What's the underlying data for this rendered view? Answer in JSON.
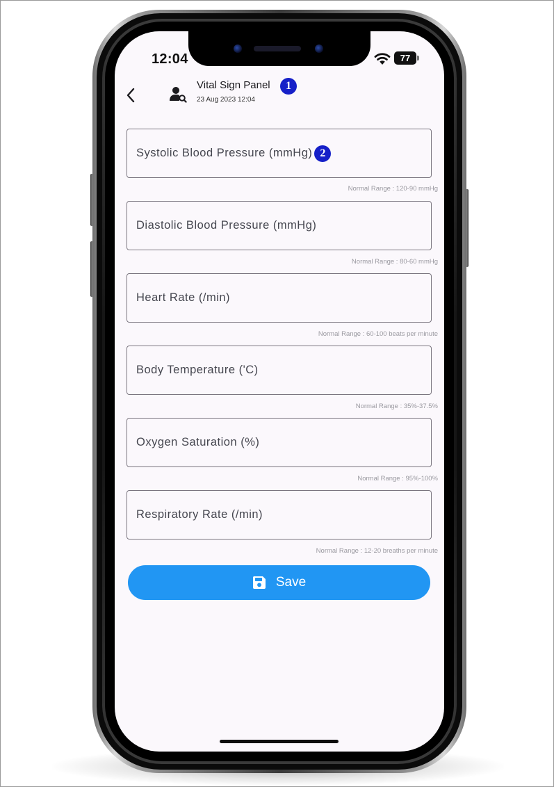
{
  "status_bar": {
    "time": "12:04",
    "battery": "77"
  },
  "header": {
    "title": "Vital Sign Panel",
    "date": "23 Aug 2023 12:04",
    "badge": "1",
    "back_icon": "chevron-left-icon",
    "user_icon": "user-search-icon"
  },
  "fields": [
    {
      "label": "Systolic Blood Pressure (mmHg)",
      "hint": "Normal Range : 120-90 mmHg",
      "badge": "2"
    },
    {
      "label": "Diastolic Blood Pressure (mmHg)",
      "hint": "Normal Range : 80-60 mmHg"
    },
    {
      "label": "Heart Rate (/min)",
      "hint": "Normal Range : 60-100 beats per minute"
    },
    {
      "label": "Body Temperature ('C)",
      "hint": "Normal Range : 35%-37.5%"
    },
    {
      "label": "Oxygen Saturation (%)",
      "hint": "Normal Range : 95%-100%"
    },
    {
      "label": "Respiratory Rate (/min)",
      "hint": "Normal Range : 12-20 breaths per minute"
    }
  ],
  "save_button": {
    "label": "Save",
    "icon": "floppy-disk-icon"
  },
  "colors": {
    "primary": "#2196f3",
    "badge": "#1620c8",
    "screen_bg": "#fbf8fc",
    "field_border": "#7a757f",
    "hint_text": "#9a99a0"
  }
}
